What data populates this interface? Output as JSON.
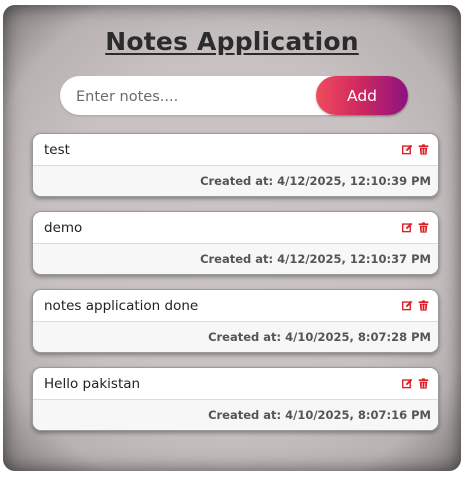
{
  "app": {
    "title": "Notes Application"
  },
  "input": {
    "placeholder": "Enter notes....",
    "value": ""
  },
  "add_button": {
    "label": "Add"
  },
  "notes": [
    {
      "text": "test",
      "created": "Created at: 4/12/2025, 12:10:39 PM"
    },
    {
      "text": "demo",
      "created": "Created at: 4/12/2025, 12:10:37 PM"
    },
    {
      "text": "notes application done",
      "created": "Created at: 4/10/2025, 8:07:28 PM"
    },
    {
      "text": "Hello pakistan",
      "created": "Created at: 4/10/2025, 8:07:16 PM"
    }
  ],
  "icons": {
    "edit": "edit-icon",
    "delete": "trash-icon"
  },
  "colors": {
    "icon_red": "#dc1f26",
    "add_gradient_start": "#ef4c5c",
    "add_gradient_end": "#8c1282"
  }
}
